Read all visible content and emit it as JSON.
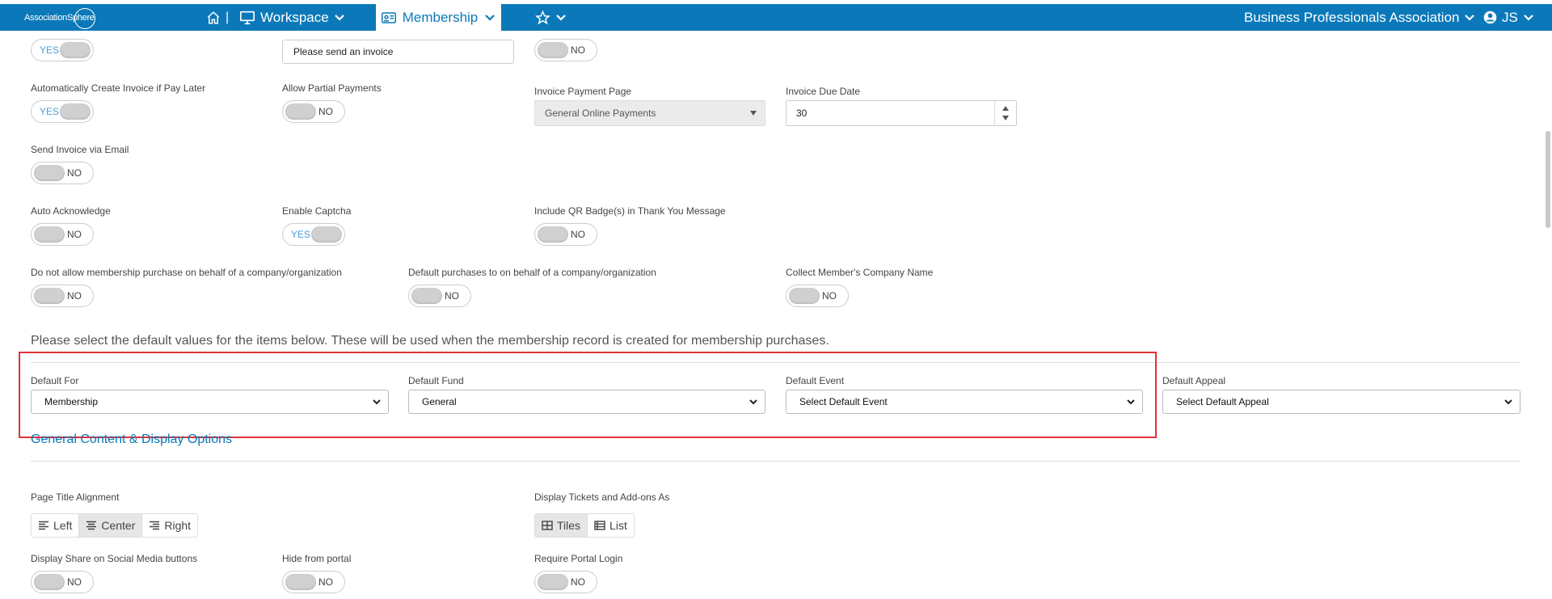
{
  "nav": {
    "logo_text": "AssociationSphere",
    "home_separator": "|",
    "workspace": "Workspace",
    "membership": "Membership",
    "org": "Business Professionals Association",
    "user_initials": "JS"
  },
  "row1": {
    "toggle1": "YES",
    "pay_later_value": "Please send an invoice",
    "toggle3": "NO"
  },
  "row2": {
    "auto_invoice_label": "Automatically Create Invoice if Pay Later",
    "auto_invoice_value": "YES",
    "partial_label": "Allow Partial Payments",
    "partial_value": "NO",
    "invoice_page_label": "Invoice Payment Page",
    "invoice_page_value": "General Online Payments",
    "due_date_label": "Invoice Due Date",
    "due_date_value": "30"
  },
  "row3": {
    "send_invoice_label": "Send Invoice via Email",
    "send_invoice_value": "NO"
  },
  "row4": {
    "auto_ack_label": "Auto Acknowledge",
    "auto_ack_value": "NO",
    "captcha_label": "Enable Captcha",
    "captcha_value": "YES",
    "qr_label": "Include QR Badge(s) in Thank You Message",
    "qr_value": "NO"
  },
  "row5": {
    "no_company_label": "Do not allow membership purchase on behalf of a company/organization",
    "no_company_value": "NO",
    "default_company_label": "Default purchases to on behalf of a company/organization",
    "default_company_value": "NO",
    "collect_company_label": "Collect Member's Company Name",
    "collect_company_value": "NO"
  },
  "defaults": {
    "intro": "Please select the default values for the items below. These will be used when the membership record is created for membership purchases.",
    "for_label": "Default For",
    "for_value": "Membership",
    "fund_label": "Default Fund",
    "fund_value": "General",
    "event_label": "Default Event",
    "event_value": "Select Default Event",
    "appeal_label": "Default Appeal",
    "appeal_value": "Select Default Appeal"
  },
  "display": {
    "section_title": "General Content & Display Options",
    "title_align_label": "Page Title Alignment",
    "align_left": "Left",
    "align_center": "Center",
    "align_right": "Right",
    "tickets_label": "Display Tickets and Add-ons As",
    "tiles": "Tiles",
    "list": "List",
    "share_label": "Display Share on Social Media buttons",
    "share_value": "NO",
    "hide_label": "Hide from portal",
    "hide_value": "NO",
    "login_label": "Require Portal Login",
    "login_value": "NO"
  },
  "colors": {
    "brand": "#0b79b9",
    "highlight": "#e0323a"
  }
}
